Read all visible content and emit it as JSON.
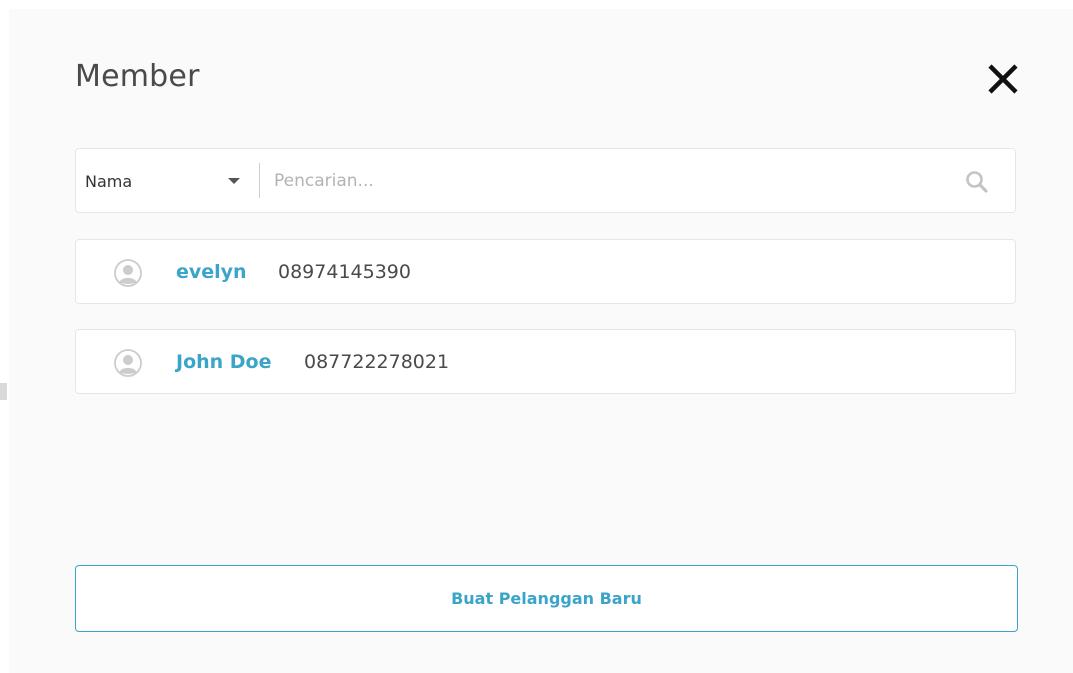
{
  "modal": {
    "title": "Member",
    "close_icon": "close-icon"
  },
  "search": {
    "filter_selected": "Nama",
    "placeholder": "Pencarian...",
    "value": "",
    "icons": [
      "chevron-down-icon",
      "search-icon"
    ]
  },
  "members": [
    {
      "name": "evelyn",
      "phone": "08974145390",
      "icon": "user-circle-icon"
    },
    {
      "name": "John Doe",
      "phone": "087722278021",
      "icon": "user-circle-icon"
    }
  ],
  "actions": {
    "create_label": "Buat Pelanggan Baru"
  },
  "colors": {
    "accent": "#3aa5c8",
    "background": "#fafafa",
    "text": "#4a4a4a"
  }
}
